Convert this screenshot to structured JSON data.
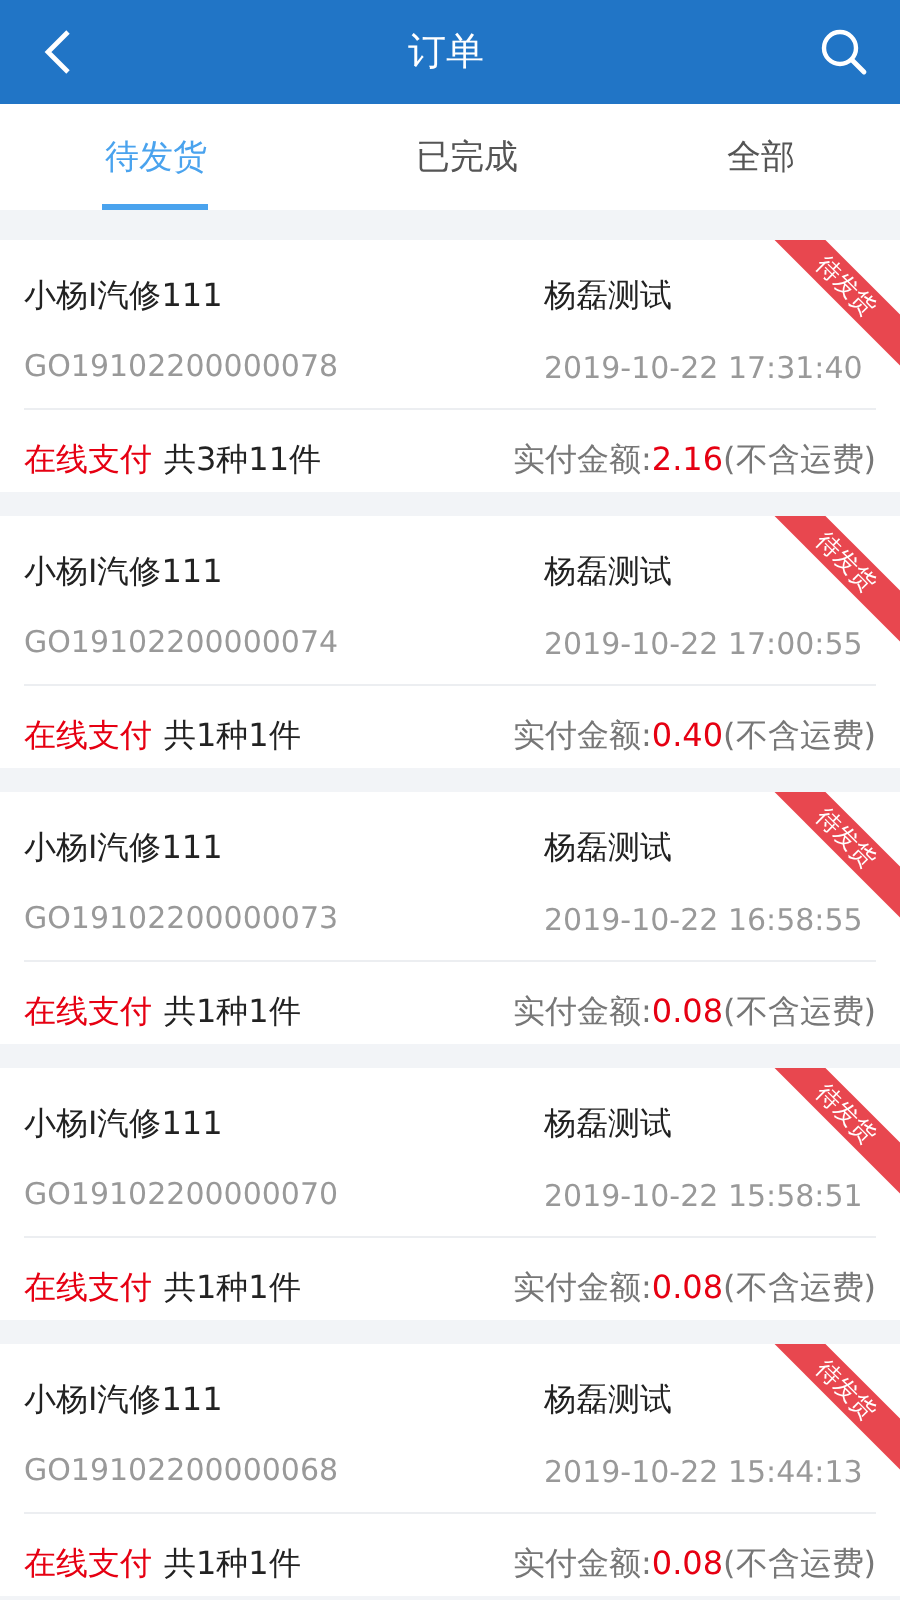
{
  "header": {
    "title": "订单"
  },
  "tabs": [
    {
      "label": "待发货",
      "selected": true
    },
    {
      "label": "已完成",
      "selected": false
    },
    {
      "label": "全部",
      "selected": false
    }
  ],
  "orders": [
    {
      "shop": "小杨I汽修111",
      "customer": "杨磊测试",
      "order_no": "GO19102200000078",
      "time": "2019-10-22 17:31:40",
      "payment": "在线支付",
      "count": "共3种11件",
      "amount_label": "实付金额:",
      "amount": "2.16",
      "amount_note": "(不含运费)",
      "status": "待发货"
    },
    {
      "shop": "小杨I汽修111",
      "customer": "杨磊测试",
      "order_no": "GO19102200000074",
      "time": "2019-10-22 17:00:55",
      "payment": "在线支付",
      "count": "共1种1件",
      "amount_label": "实付金额:",
      "amount": "0.40",
      "amount_note": "(不含运费)",
      "status": "待发货"
    },
    {
      "shop": "小杨I汽修111",
      "customer": "杨磊测试",
      "order_no": "GO19102200000073",
      "time": "2019-10-22 16:58:55",
      "payment": "在线支付",
      "count": "共1种1件",
      "amount_label": "实付金额:",
      "amount": "0.08",
      "amount_note": "(不含运费)",
      "status": "待发货"
    },
    {
      "shop": "小杨I汽修111",
      "customer": "杨磊测试",
      "order_no": "GO19102200000070",
      "time": "2019-10-22 15:58:51",
      "payment": "在线支付",
      "count": "共1种1件",
      "amount_label": "实付金额:",
      "amount": "0.08",
      "amount_note": "(不含运费)",
      "status": "待发货"
    },
    {
      "shop": "小杨I汽修111",
      "customer": "杨磊测试",
      "order_no": "GO19102200000068",
      "time": "2019-10-22 15:44:13",
      "payment": "在线支付",
      "count": "共1种1件",
      "amount_label": "实付金额:",
      "amount": "0.08",
      "amount_note": "(不含运费)",
      "status": "待发货"
    }
  ]
}
